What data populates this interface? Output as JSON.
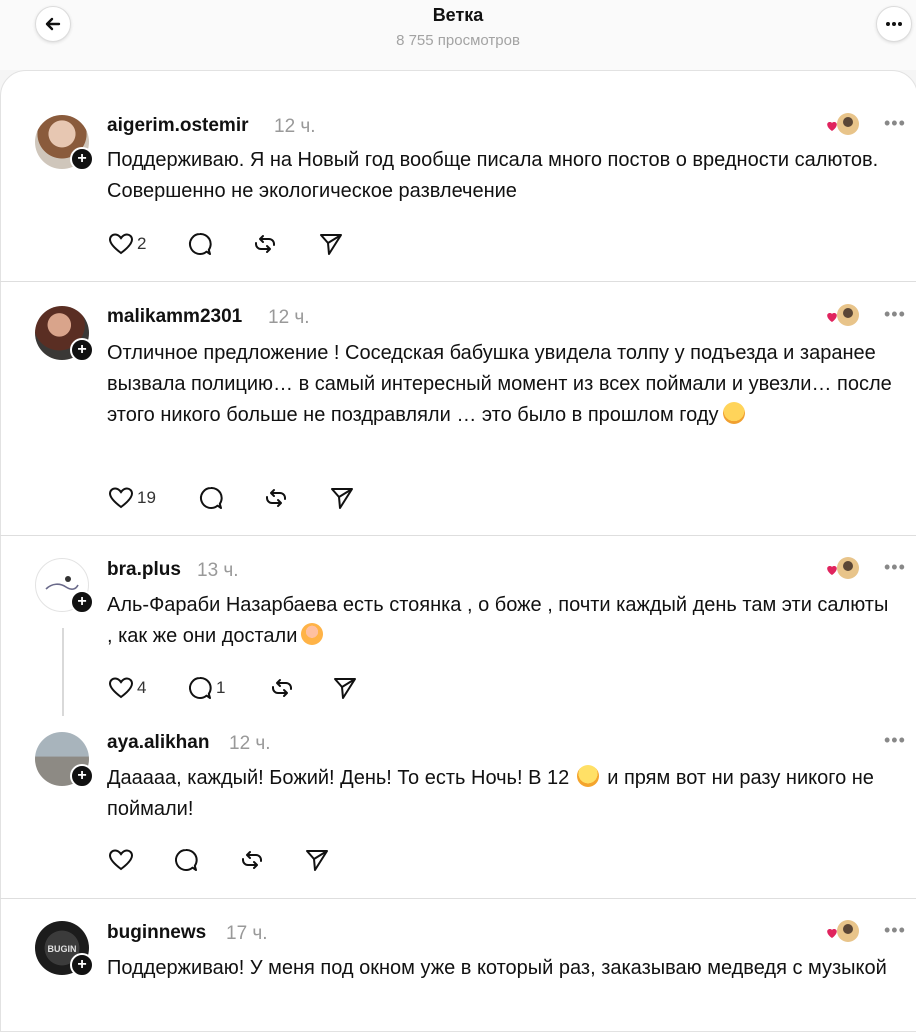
{
  "header": {
    "title": "Ветка",
    "views": "8 755 просмотров"
  },
  "posts": [
    {
      "username": "aigerim.ostemir",
      "time": "12 ч.",
      "text": "Поддерживаю. Я на Новый год вообще писала много постов о вредности салютов. Совершенно не экологическое развлечение",
      "likes": "2",
      "replies": ""
    },
    {
      "username": "malikamm2301",
      "time": "12 ч.",
      "text": "Отличное предложение ! Соседская бабушка увидела толпу у подъезда и заранее вызвала полицию… в самый интересный момент из всех поймали и увезли… после этого никого больше не поздравляли … это было в прошлом году",
      "likes": "19",
      "replies": ""
    },
    {
      "username": "bra.plus",
      "time": "13 ч.",
      "text": "Аль-Фараби Назарбаева есть стоянка , о боже , почти каждый день там эти салюты , как же они достали",
      "likes": "4",
      "replies": "1"
    },
    {
      "username": "aya.alikhan",
      "time": "12 ч.",
      "text1": "Дааааа, каждый! Божий! День! То есть Ночь! В 12",
      "text2": "и прям вот ни разу никого не поймали!",
      "likes": "",
      "replies": ""
    },
    {
      "username": "buginnews",
      "time": "17 ч.",
      "text": "Поддерживаю! У меня под окном уже в который раз, заказываю медведя с музыкой",
      "likes": "",
      "replies": ""
    }
  ],
  "icons": {
    "back": "arrow-left-icon",
    "more": "more-horizontal-icon",
    "like": "heart-icon",
    "reply": "comment-icon",
    "repost": "repost-icon",
    "share": "send-icon",
    "follow": "plus-icon",
    "reaction": "heart-avatar-icon"
  },
  "colors": {
    "text": "#111111",
    "muted": "#999999",
    "reaction_heart": "#e0245e",
    "separator": "#dedede"
  }
}
